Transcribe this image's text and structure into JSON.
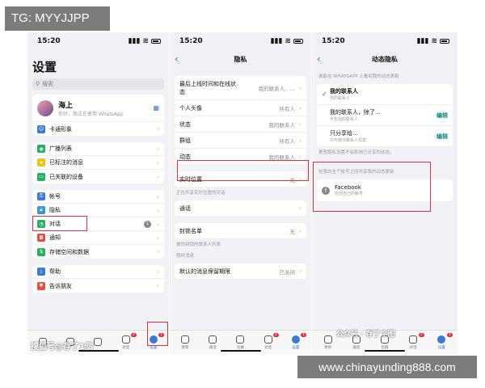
{
  "overlays": {
    "tg_label": "TG: MYYJJPP",
    "site_label": "www.chinayunding888.com",
    "watermark_left": "搜狐号@存了1個",
    "watermark_right": "公众号 · 存了个图"
  },
  "phone1": {
    "time": "15:20",
    "title": "设置",
    "search_placeholder": "搜索",
    "profile": {
      "name": "海上",
      "status": "你好，我正在使用 WhatsApp"
    },
    "groups": [
      [
        {
          "label": "卡通形象",
          "icon": "avatar-icon",
          "color": "#3a7ad0"
        }
      ],
      [
        {
          "label": "广播列表",
          "icon": "broadcast-icon",
          "color": "#27ae60"
        },
        {
          "label": "已标注的消息",
          "icon": "star-icon",
          "color": "#f1c40f"
        },
        {
          "label": "已关联的设备",
          "icon": "laptop-icon",
          "color": "#27ae60"
        }
      ],
      [
        {
          "label": "帐号",
          "icon": "key-icon",
          "color": "#3a7ad0"
        },
        {
          "label": "隐私",
          "icon": "lock-icon",
          "color": "#3a9ad0"
        },
        {
          "label": "对话",
          "icon": "chat-icon",
          "color": "#27ae60",
          "badge": "1"
        },
        {
          "label": "通知",
          "icon": "bell-icon",
          "color": "#e74c3c"
        },
        {
          "label": "存储空间和数据",
          "icon": "storage-icon",
          "color": "#27ae60"
        }
      ],
      [
        {
          "label": "帮助",
          "icon": "info-icon",
          "color": "#3a7ad0"
        },
        {
          "label": "告诉朋友",
          "icon": "heart-icon",
          "color": "#e74c3c"
        }
      ]
    ],
    "tabs": [
      {
        "label": "",
        "icon": "status-tab-icon"
      },
      {
        "label": "",
        "icon": "calls-tab-icon"
      },
      {
        "label": "",
        "icon": "communities-tab-icon"
      },
      {
        "label": "对话",
        "icon": "chats-tab-icon",
        "badge": "2"
      },
      {
        "label": "设置",
        "icon": "settings-tab-icon",
        "active": true,
        "badge": "1"
      }
    ]
  },
  "phone2": {
    "time": "15:20",
    "title": "隐私",
    "rows": [
      {
        "label": "最后上线时间和在线状态",
        "value": "我的联系人、..."
      },
      {
        "label": "个人头像",
        "value": "所有人"
      },
      {
        "label": "状态",
        "value": "我的联系人"
      },
      {
        "label": "群组",
        "value": "所有人"
      },
      {
        "label": "动态",
        "value": "我的联系人"
      }
    ],
    "live_location": {
      "label": "实时位置",
      "value": "无"
    },
    "live_location_note": "正在共享实时位置的对话",
    "calls": {
      "label": "通话"
    },
    "blocked": {
      "label": "封锁名单",
      "value": "无"
    },
    "blocked_note": "被你封锁的联系人列表",
    "timer_header": "限时消息",
    "default_timer": {
      "label": "默认的消息保留期限",
      "value": "已关闭"
    },
    "tabs": [
      {
        "label": "更新",
        "icon": "status-tab-icon"
      },
      {
        "label": "通话",
        "icon": "calls-tab-icon"
      },
      {
        "label": "社群",
        "icon": "communities-tab-icon"
      },
      {
        "label": "对话",
        "icon": "chats-tab-icon",
        "badge": "2"
      },
      {
        "label": "设置",
        "icon": "settings-tab-icon",
        "active": true,
        "badge": "1"
      }
    ]
  },
  "phone3": {
    "time": "15:20",
    "title": "动态隐私",
    "section_header": "谁能在 WHATSAPP 上看到我的动态更新",
    "options": [
      {
        "label": "我的联系人",
        "sub": "你的联系人",
        "checked": true,
        "edit": ""
      },
      {
        "label": "我的联系人，除了...",
        "sub": "不包括的联系人",
        "checked": false,
        "edit": "编辑"
      },
      {
        "label": "只分享给...",
        "sub": "只与部分联系人共享",
        "checked": false,
        "edit": "编辑"
      }
    ],
    "options_note": "更改隐私设置不会影响已分享的动态。",
    "shared_header": "在我的全个帐号之间共享我的动态更新",
    "facebook": {
      "label": "Facebook",
      "sub": "在您自己的帐号"
    },
    "tabs": [
      {
        "label": "更新",
        "icon": "status-tab-icon"
      },
      {
        "label": "通话",
        "icon": "calls-tab-icon"
      },
      {
        "label": "社群",
        "icon": "communities-tab-icon"
      },
      {
        "label": "对话",
        "icon": "chats-tab-icon",
        "badge": "2"
      },
      {
        "label": "设置",
        "icon": "settings-tab-icon",
        "active": true,
        "badge": "1"
      }
    ]
  }
}
